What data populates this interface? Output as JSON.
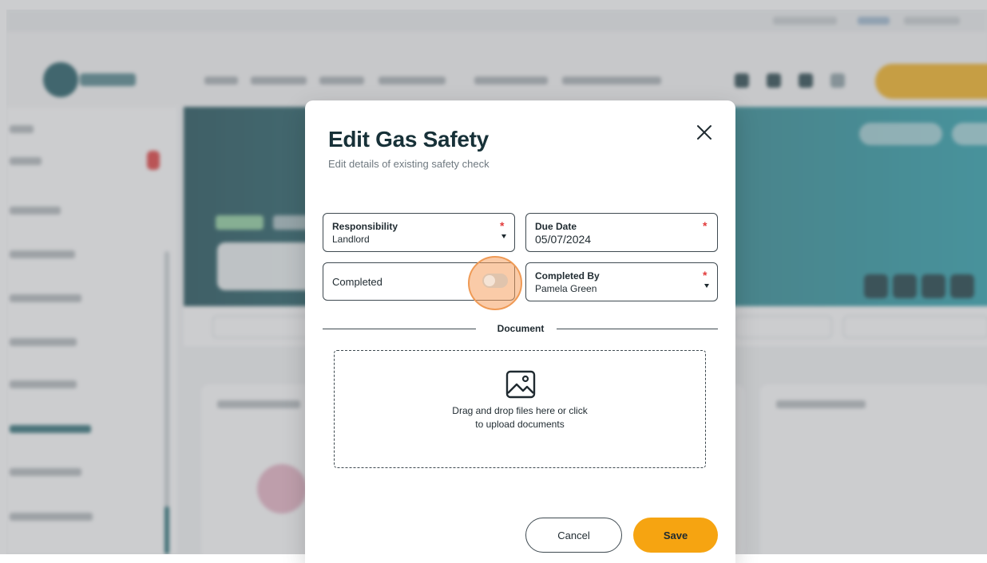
{
  "modal": {
    "title": "Edit Gas Safety",
    "subtitle": "Edit details of existing safety check",
    "close_icon": "close-icon"
  },
  "form": {
    "responsibility": {
      "label": "Responsibility",
      "value": "Landlord",
      "required": true
    },
    "due_date": {
      "label": "Due Date",
      "value": "05/07/2024",
      "required": true
    },
    "completed": {
      "label": "Completed",
      "checked": false
    },
    "completed_by": {
      "label": "Completed By",
      "value": "Pamela Green",
      "required": true
    }
  },
  "document": {
    "section_label": "Document",
    "dropzone_icon": "image-icon",
    "dropzone_line1": "Drag and drop files here or click",
    "dropzone_line2": "to upload documents"
  },
  "actions": {
    "cancel_label": "Cancel",
    "save_label": "Save"
  },
  "colors": {
    "accent": "#f6a411",
    "title": "#173138",
    "required": "#e23b3b",
    "highlight": "#ef9a55",
    "hero_dark": "#1d4f57",
    "hero_light": "#2aa1ad"
  }
}
